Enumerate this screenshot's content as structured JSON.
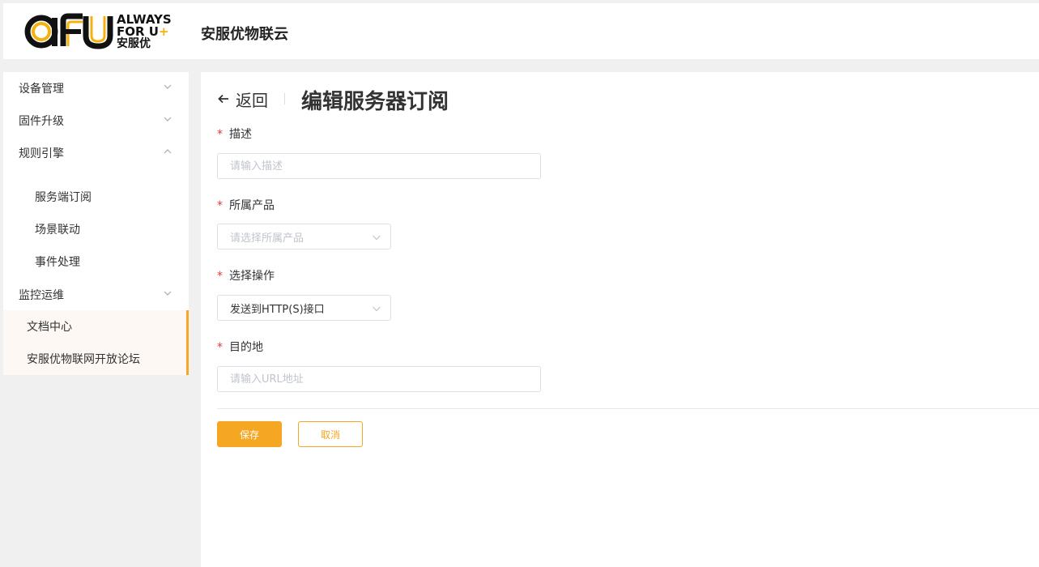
{
  "header": {
    "logo_text": "AFU",
    "logo_tagline": "ALWAYS FOR U+",
    "logo_cn": "安服优",
    "app_title": "安服优物联云"
  },
  "sidebar": {
    "items": [
      {
        "label": "设备管理",
        "icon": "chevron-down-icon"
      },
      {
        "label": "固件升级",
        "icon": "chevron-down-icon"
      },
      {
        "label": "规则引擎",
        "icon": "chevron-up-icon"
      },
      {
        "label": "服务端订阅"
      },
      {
        "label": "场景联动"
      },
      {
        "label": "事件处理"
      },
      {
        "label": "监控运维",
        "icon": "chevron-down-icon"
      },
      {
        "label": "文档中心"
      },
      {
        "label": "安服优物联网开放论坛"
      }
    ]
  },
  "main": {
    "back_label": "返回",
    "title": "编辑服务器订阅",
    "form": {
      "description": {
        "label": "描述",
        "placeholder": "请输入描述",
        "value": ""
      },
      "product": {
        "label": "所属产品",
        "placeholder": "请选择所属产品"
      },
      "operation": {
        "label": "选择操作",
        "value": "发送到HTTP(S)接口"
      },
      "destination": {
        "label": "目的地",
        "placeholder": "请输入URL地址",
        "value": ""
      }
    },
    "save_label": "保存",
    "cancel_label": "取消"
  },
  "colors": {
    "accent": "#f5a623",
    "required": "#e53935",
    "logo_yellow": "#f5b20e"
  }
}
